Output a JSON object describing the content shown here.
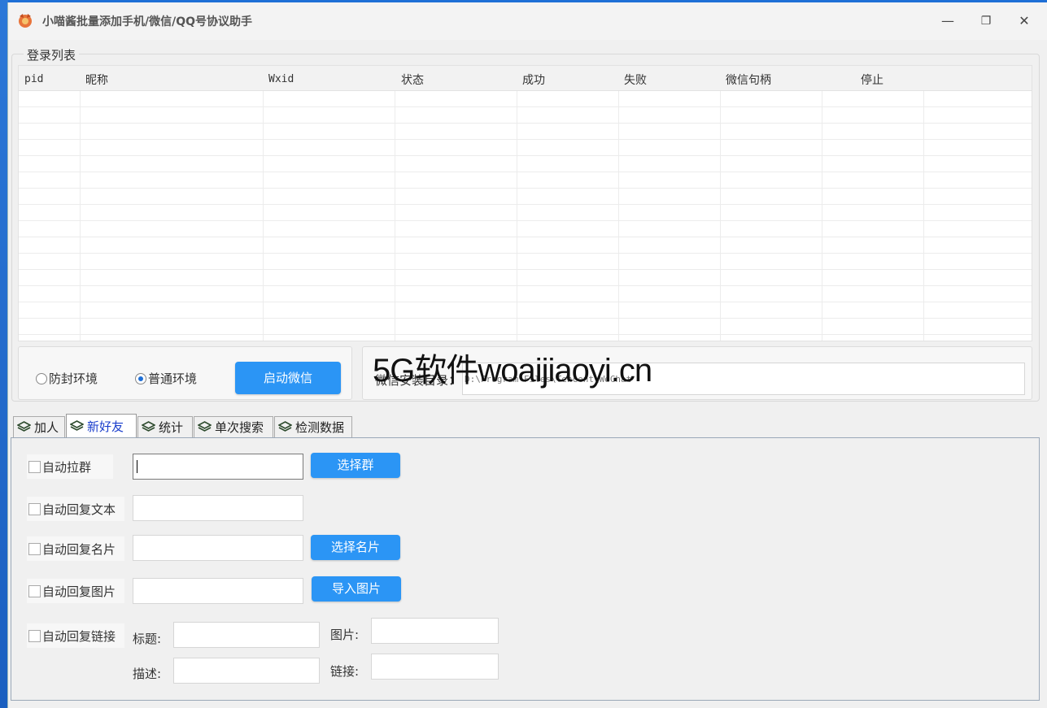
{
  "window": {
    "title": "小喵酱批量添加手机/微信/QQ号协议助手",
    "icon": "app-icon",
    "minimize_glyph": "—",
    "restore_glyph": "❐",
    "close_glyph": "✕"
  },
  "login_list": {
    "group_title": "登录列表",
    "columns": [
      "pid",
      "昵称",
      "Wxid",
      "状态",
      "成功",
      "失败",
      "微信句柄",
      "停止"
    ],
    "rows": []
  },
  "environment": {
    "option_protect": "防封环境",
    "option_normal": "普通环境",
    "selected": "普通环境",
    "start_button": "启动微信"
  },
  "install_dir": {
    "label": "微信安装目录：",
    "value": "D:\\Program Files\\Tencent\\WeChat"
  },
  "watermark": "5G软件woaijiaoyi.cn",
  "tabs": [
    {
      "label": "加人",
      "icon": "layers-icon"
    },
    {
      "label": "新好友",
      "icon": "layers-icon",
      "active": true
    },
    {
      "label": "统计",
      "icon": "layers-icon"
    },
    {
      "label": "单次搜索",
      "icon": "layers-icon"
    },
    {
      "label": "检测数据",
      "icon": "layers-icon"
    }
  ],
  "new_friend": {
    "auto_pull_group": {
      "label": "自动拉群",
      "value": "",
      "button": "选择群"
    },
    "auto_reply_text": {
      "label": "自动回复文本",
      "value": ""
    },
    "auto_reply_card": {
      "label": "自动回复名片",
      "value": "",
      "button": "选择名片"
    },
    "auto_reply_image": {
      "label": "自动回复图片",
      "value": "",
      "button": "导入图片"
    },
    "auto_reply_link": {
      "label": "自动回复链接",
      "title_label": "标题:",
      "desc_label": "描述:",
      "image_label": "图片:",
      "link_label": "链接:"
    }
  },
  "colors": {
    "accent_button": "#2b95f5",
    "active_tab_text": "#1a3ecc",
    "desktop": "#1e6fd6"
  }
}
